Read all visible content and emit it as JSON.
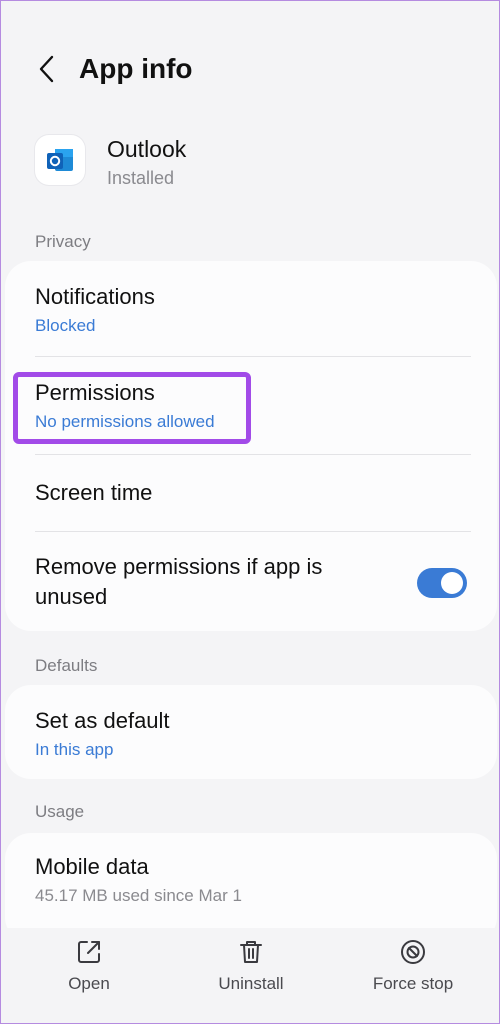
{
  "header": {
    "title": "App info"
  },
  "app": {
    "name": "Outlook",
    "status": "Installed",
    "icon": "outlook-icon"
  },
  "sections": {
    "privacy": "Privacy",
    "defaults": "Defaults",
    "usage": "Usage"
  },
  "privacy": {
    "notifications": {
      "title": "Notifications",
      "sub": "Blocked"
    },
    "permissions": {
      "title": "Permissions",
      "sub": "No permissions allowed"
    },
    "screen_time": {
      "title": "Screen time"
    },
    "remove_unused": {
      "title_line1": "Remove permissions if app is",
      "title_line2": "unused",
      "enabled": true
    }
  },
  "defaults": {
    "set_default": {
      "title": "Set as default",
      "sub": "In this app"
    }
  },
  "usage": {
    "mobile_data": {
      "title": "Mobile data",
      "sub": "45.17 MB used since Mar 1"
    }
  },
  "bottom_bar": {
    "open": "Open",
    "uninstall": "Uninstall",
    "force_stop": "Force stop"
  },
  "colors": {
    "accent": "#3a7bd5",
    "highlight": "#a24be8"
  }
}
